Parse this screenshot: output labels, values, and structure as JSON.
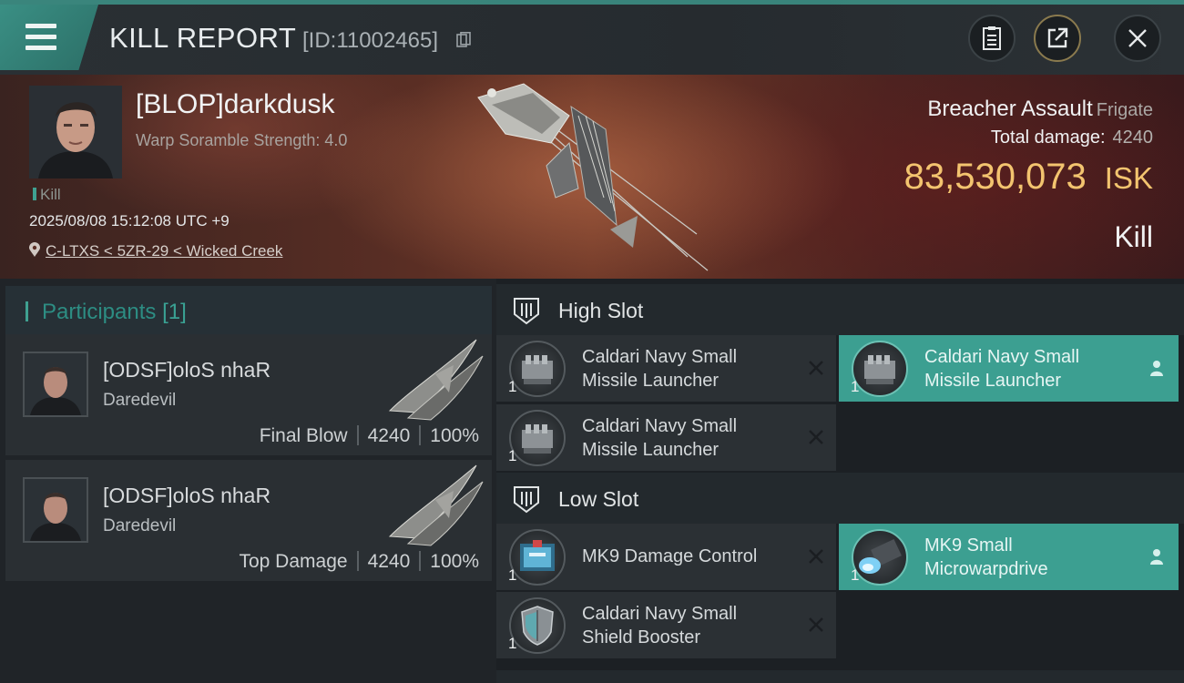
{
  "header": {
    "title": "KILL REPORT",
    "report_id": "[ID:11002465]",
    "buttons": [
      "menu-icon",
      "clipboard-icon",
      "share-icon",
      "close-icon"
    ]
  },
  "victim": {
    "name": "[BLOP]darkdusk",
    "warp_scramble": "Warp Soramble Strength: 4.0",
    "tag": "Kill",
    "datetime": "2025/08/08 15:12:08 UTC +9",
    "location": "C-LTXS < 5ZR-29 < Wicked Creek",
    "ship_name": "Breacher Assault",
    "ship_class": "Frigate",
    "total_damage_label": "Total damage:",
    "total_damage": "4240",
    "isk_value": "83,530,073",
    "isk_unit": "ISK",
    "result": "Kill"
  },
  "participants": {
    "title": "Participants",
    "count": "[1]",
    "items": [
      {
        "name": "[ODSF]oloS nhaR",
        "ship": "Daredevil",
        "role": "Final Blow",
        "damage": "4240",
        "percent": "100%"
      },
      {
        "name": "[ODSF]oloS nhaR",
        "ship": "Daredevil",
        "role": "Top Damage",
        "damage": "4240",
        "percent": "100%"
      }
    ]
  },
  "fitting": {
    "high_slot": {
      "title": "High Slot",
      "modules": [
        {
          "name_line1": "Caldari Navy Small",
          "name_line2": "Missile Launcher",
          "qty": "1",
          "status": "destroyed"
        },
        {
          "name_line1": "Caldari Navy Small",
          "name_line2": "Missile Launcher",
          "qty": "1",
          "status": "dropped"
        },
        {
          "name_line1": "Caldari Navy Small",
          "name_line2": "Missile Launcher",
          "qty": "1",
          "status": "destroyed"
        }
      ]
    },
    "low_slot": {
      "title": "Low Slot",
      "modules": [
        {
          "name_line1": "MK9 Damage Control",
          "name_line2": "",
          "qty": "1",
          "status": "destroyed"
        },
        {
          "name_line1": "MK9 Small",
          "name_line2": "Microwarpdrive",
          "qty": "1",
          "status": "dropped"
        },
        {
          "name_line1": "Caldari Navy Small",
          "name_line2": "Shield Booster",
          "qty": "1",
          "status": "destroyed"
        }
      ]
    }
  },
  "colors": {
    "accent": "#3c9f91",
    "isk": "#f3c46f"
  }
}
